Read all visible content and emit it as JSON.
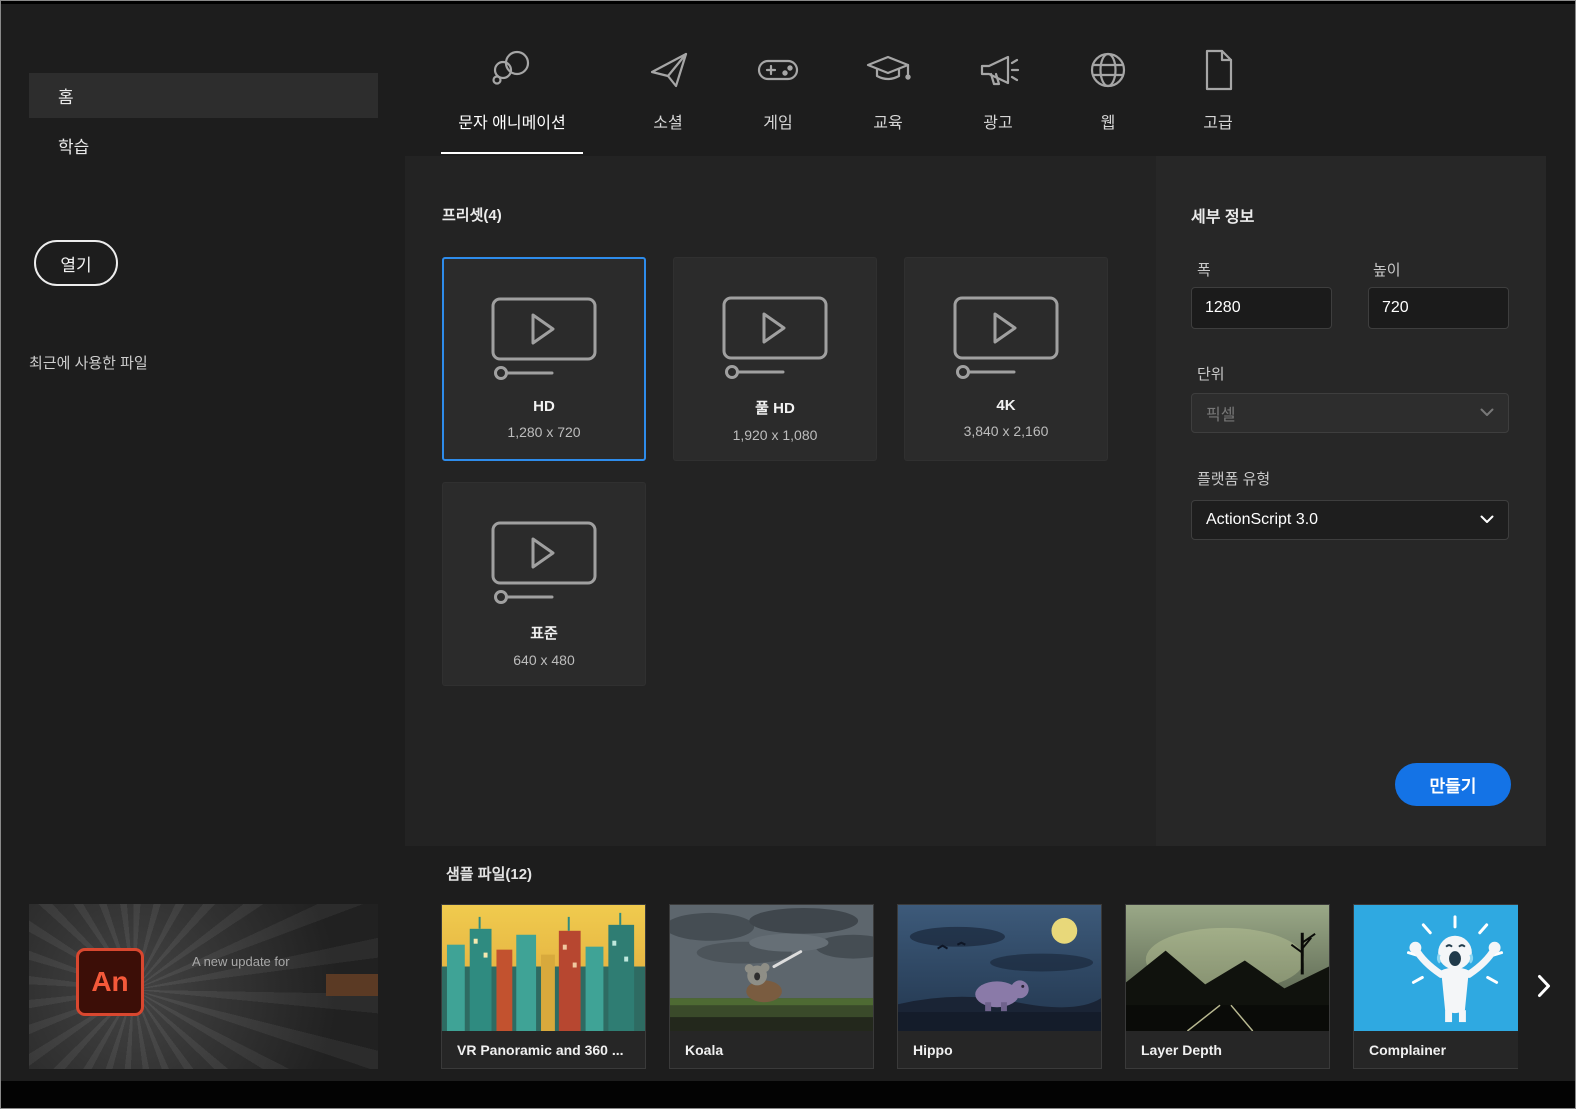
{
  "sidebar": {
    "home_label": "홈",
    "learn_label": "학습",
    "open_button": "열기",
    "recent_files_label": "최근에 사용한 파일"
  },
  "tabs": {
    "items": [
      {
        "label": "문자 애니메이션",
        "icon": "character-animation-icon",
        "active": true
      },
      {
        "label": "소셜",
        "icon": "paper-plane-icon",
        "active": false
      },
      {
        "label": "게임",
        "icon": "game-controller-icon",
        "active": false
      },
      {
        "label": "교육",
        "icon": "graduation-cap-icon",
        "active": false
      },
      {
        "label": "광고",
        "icon": "megaphone-icon",
        "active": false
      },
      {
        "label": "웹",
        "icon": "globe-icon",
        "active": false
      },
      {
        "label": "고급",
        "icon": "document-icon",
        "active": false
      }
    ]
  },
  "presets": {
    "title": "프리셋(4)",
    "items": [
      {
        "name": "HD",
        "size": "1,280 x 720",
        "selected": true
      },
      {
        "name": "풀 HD",
        "size": "1,920 x 1,080",
        "selected": false
      },
      {
        "name": "4K",
        "size": "3,840 x 2,160",
        "selected": false
      },
      {
        "name": "표준",
        "size": "640 x 480",
        "selected": false
      }
    ]
  },
  "details": {
    "title": "세부 정보",
    "width_label": "폭",
    "width_value": "1280",
    "height_label": "높이",
    "height_value": "720",
    "unit_label": "단위",
    "unit_value": "픽셀",
    "platform_label": "플랫폼 유형",
    "platform_value": "ActionScript 3.0",
    "create_button": "만들기"
  },
  "samples": {
    "title": "샘플 파일(12)",
    "items": [
      {
        "name": "VR Panoramic and 360 ..."
      },
      {
        "name": "Koala"
      },
      {
        "name": "Hippo"
      },
      {
        "name": "Layer Depth"
      },
      {
        "name": "Complainer"
      }
    ]
  },
  "banner": {
    "logo_text": "An",
    "text": "A new update for"
  },
  "colors": {
    "accent_blue": "#1473e6",
    "selected_border": "#2e8ceb",
    "background": "#1d1d1d",
    "panel": "#232323"
  }
}
